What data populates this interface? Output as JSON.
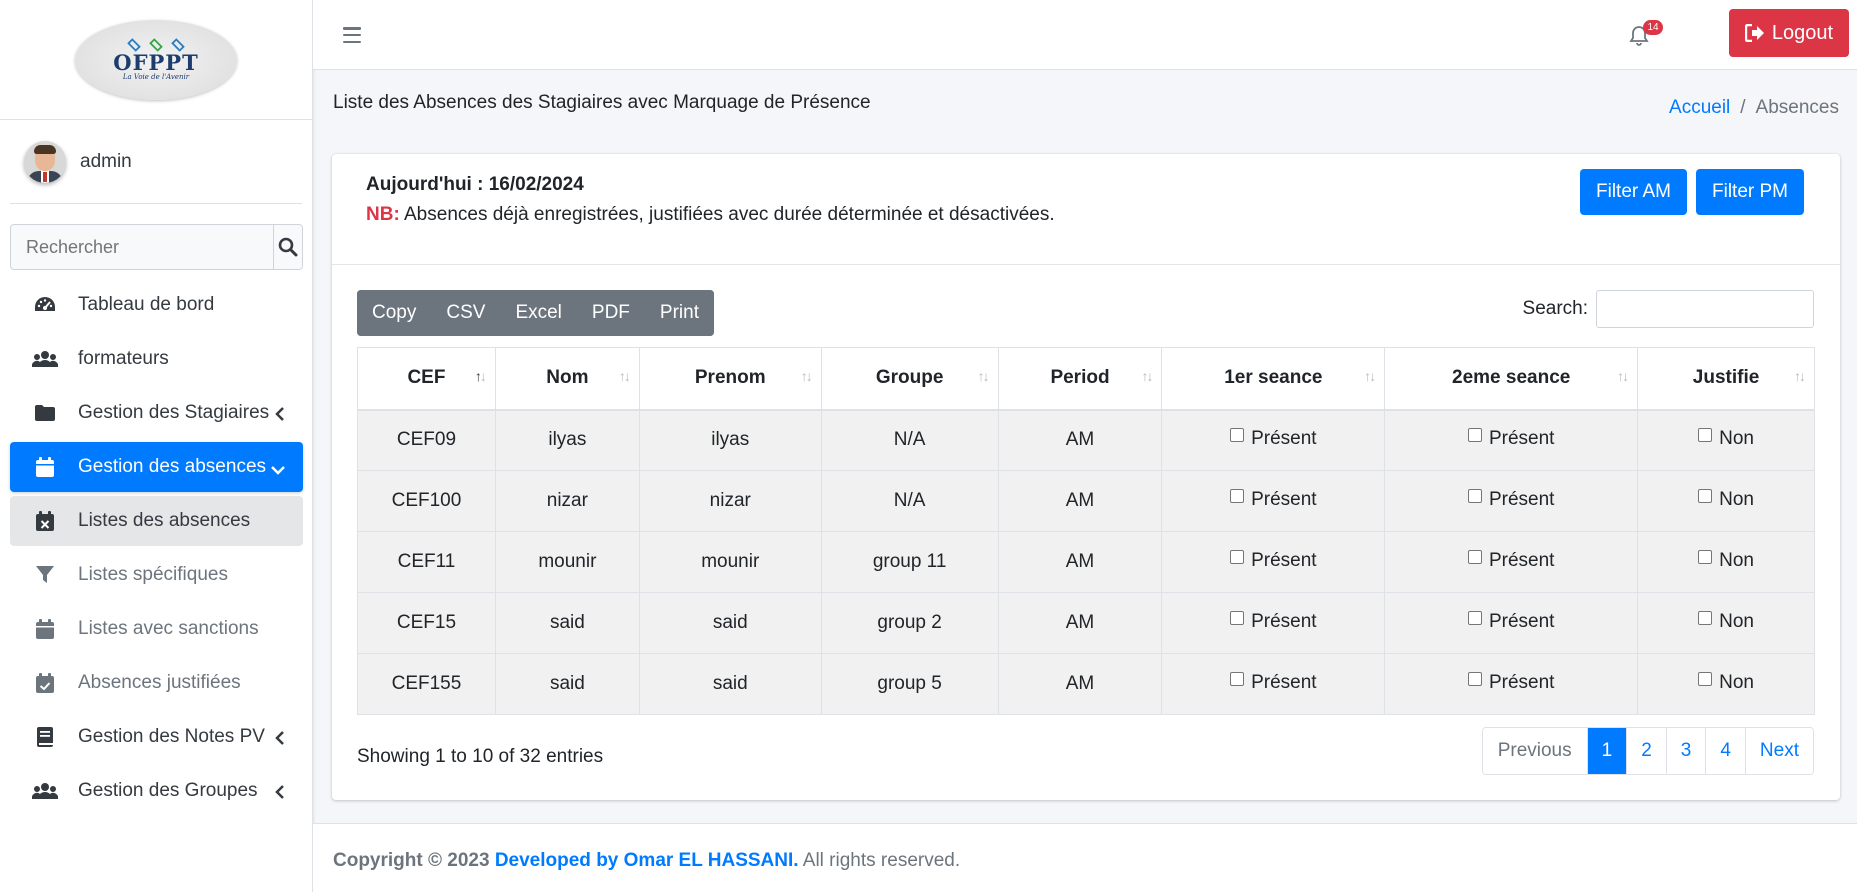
{
  "brand": {
    "logo_text": "OFPPT",
    "logo_subtitle": "La Voie de l'Avenir"
  },
  "user": {
    "name": "admin"
  },
  "sidebar_search": {
    "placeholder": "Rechercher"
  },
  "nav": {
    "dashboard": "Tableau de bord",
    "trainers": "formateurs",
    "trainees": "Gestion des Stagiaires",
    "absences": "Gestion des absences",
    "absences_list": "Listes des absences",
    "specific_lists": "Listes spécifiques",
    "sanctions_lists": "Listes avec sanctions",
    "justified": "Absences justifiées",
    "notes": "Gestion des Notes PV",
    "groups": "Gestion des Groupes"
  },
  "topbar": {
    "notification_count": "14",
    "logout_label": "Logout"
  },
  "page": {
    "title": "Liste des Absences des Stagiaires avec Marquage de Présence",
    "breadcrumb_home": "Accueil",
    "breadcrumb_sep": "/",
    "breadcrumb_current": "Absences"
  },
  "card": {
    "today": "Aujourd'hui : 16/02/2024",
    "nb_label": "NB:",
    "nb_text": " Absences déjà enregistrées, justifiées avec durée déterminée et désactivées.",
    "filter_am": "Filter AM",
    "filter_pm": "Filter PM"
  },
  "export_buttons": [
    "Copy",
    "CSV",
    "Excel",
    "PDF",
    "Print"
  ],
  "table_search_label": "Search:",
  "table": {
    "headers": [
      "CEF",
      "Nom",
      "Prenom",
      "Groupe",
      "Period",
      "1er seance",
      "2eme seance",
      "Justifie"
    ],
    "rows": [
      [
        "CEF09",
        "ilyas",
        "ilyas",
        "N/A",
        "AM",
        "Présent",
        "Présent",
        "Non"
      ],
      [
        "CEF100",
        "nizar",
        "nizar",
        "N/A",
        "AM",
        "Présent",
        "Présent",
        "Non"
      ],
      [
        "CEF11",
        "mounir",
        "mounir",
        "group 11",
        "AM",
        "Présent",
        "Présent",
        "Non"
      ],
      [
        "CEF15",
        "said",
        "said",
        "group 2",
        "AM",
        "Présent",
        "Présent",
        "Non"
      ],
      [
        "CEF155",
        "said",
        "said",
        "group 5",
        "AM",
        "Présent",
        "Présent",
        "Non"
      ]
    ]
  },
  "table_info": "Showing 1 to 10 of 32 entries",
  "pagination": {
    "previous": "Previous",
    "pages": [
      "1",
      "2",
      "3",
      "4"
    ],
    "next": "Next"
  },
  "footer": {
    "copyright": "Copyright © 2023",
    "developer": "Developed by Omar EL HASSANI.",
    "rights": " All rights reserved."
  },
  "colors": {
    "primary": "#007bff",
    "danger": "#dc3545",
    "secondary": "#6c757d"
  },
  "icons": {
    "dashboard": "tachometer-icon",
    "trainers": "users-icon",
    "trainees": "folder-icon",
    "absences": "calendar-icon",
    "absences_list": "calendar-x-icon",
    "specific_lists": "filter-icon",
    "sanctions_lists": "calendar-icon",
    "justified": "calendar-check-icon",
    "notes": "book-icon",
    "groups": "users-icon"
  }
}
